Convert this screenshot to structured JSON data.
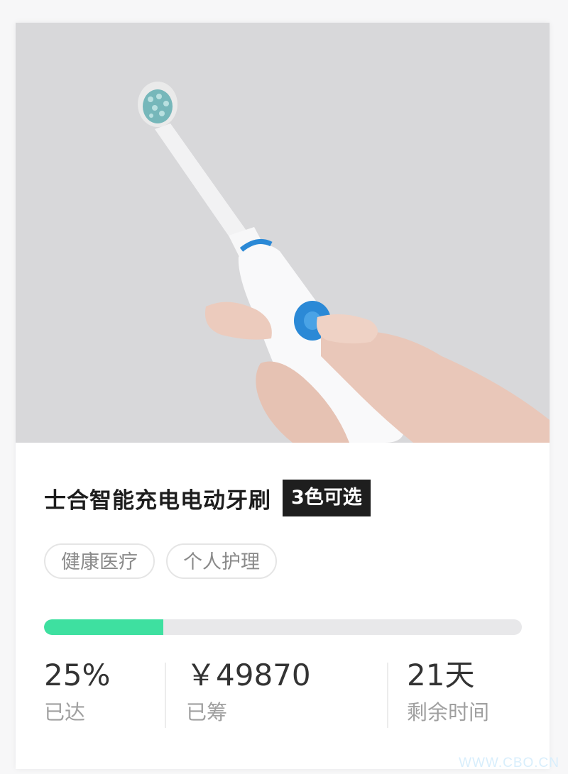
{
  "product": {
    "title": "士合智能充电电动牙刷",
    "color_badge": "3色可选",
    "tags": [
      "健康医疗",
      "个人护理"
    ],
    "image": "electric-toothbrush-in-hand"
  },
  "funding": {
    "progress_fraction": 0.25,
    "progress_color": "#3ee0a0",
    "percent_value": "25%",
    "percent_label": "已达",
    "raised_value": "￥49870",
    "raised_label": "已筹",
    "days_value": "21天",
    "days_label": "剩余时间"
  },
  "watermark": "WWW.CBO.CN"
}
